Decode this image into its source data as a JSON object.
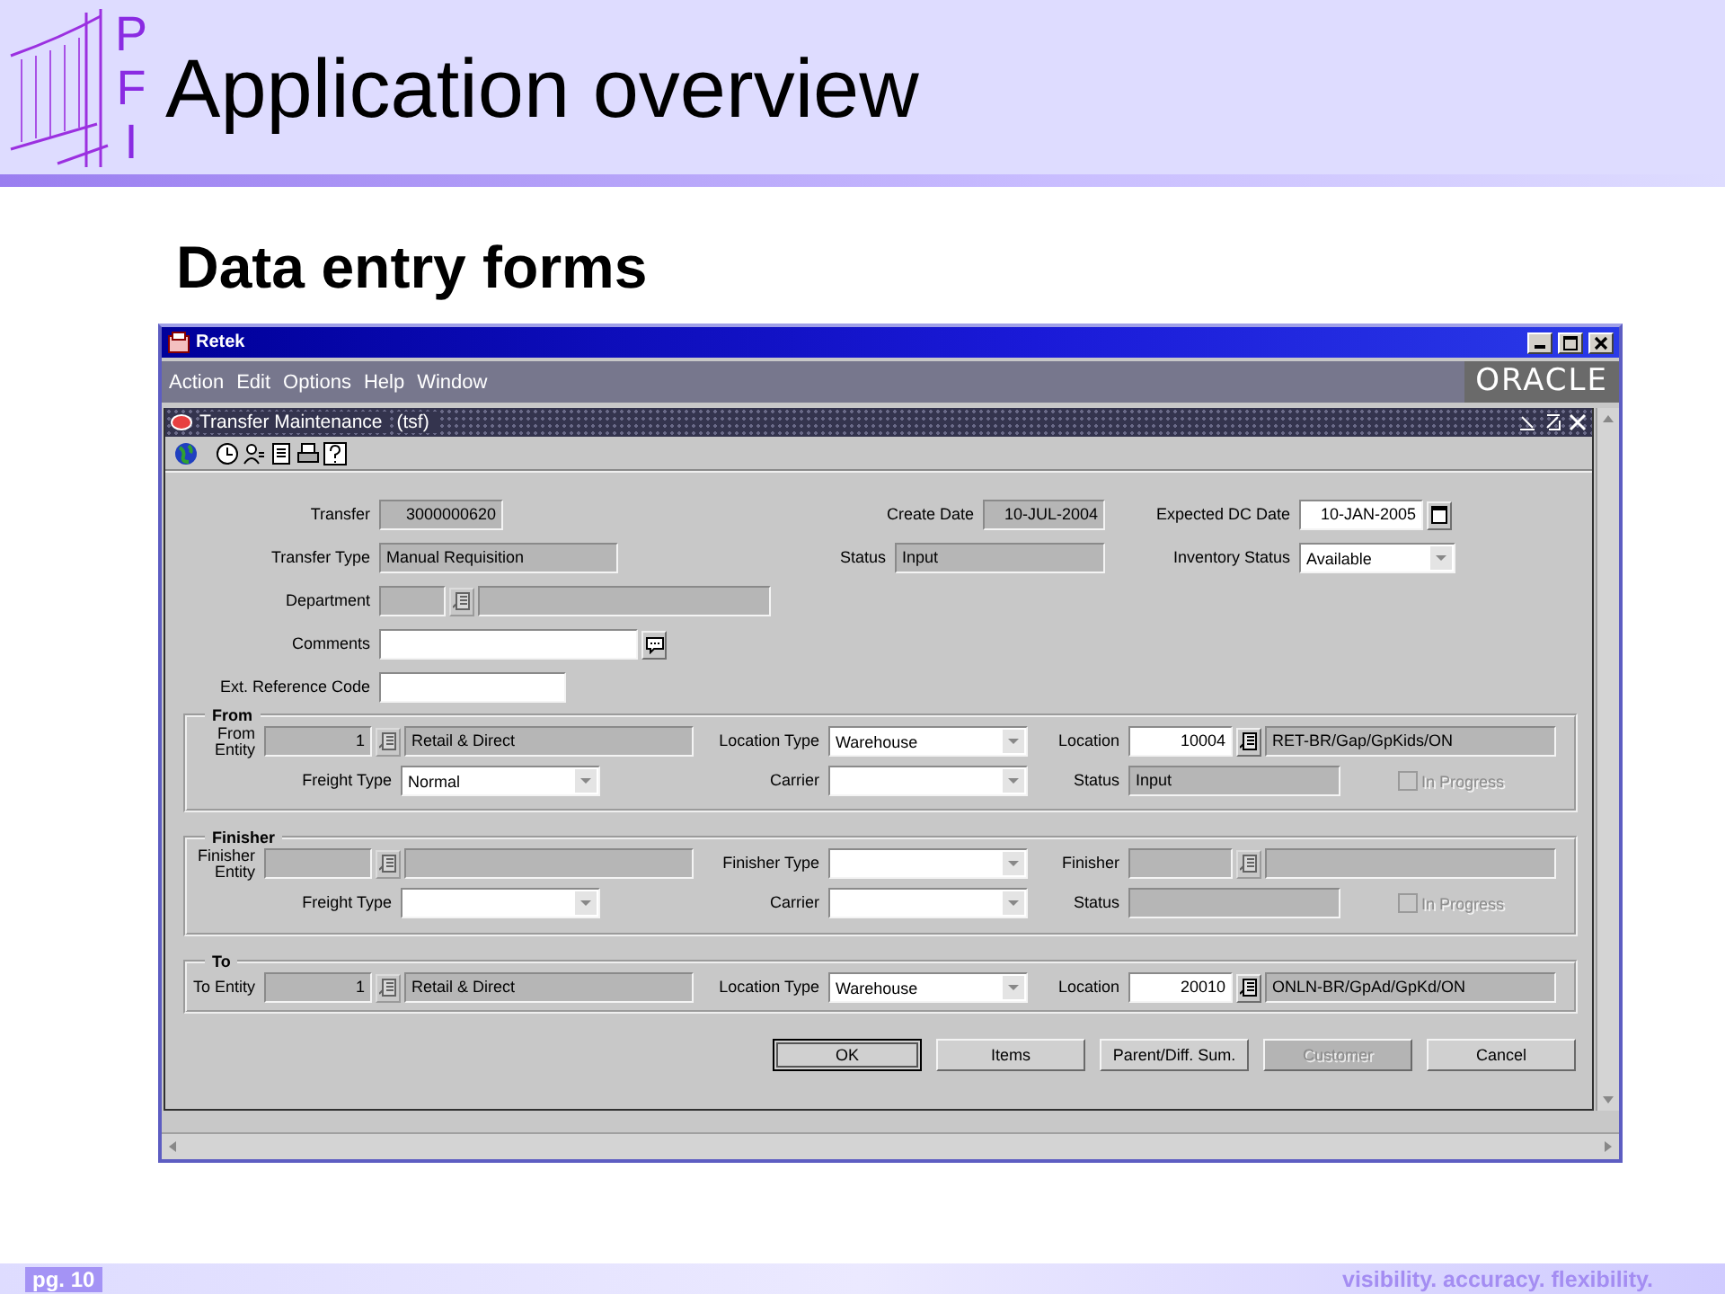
{
  "slide": {
    "logo_letters": [
      "P",
      "F",
      "I"
    ],
    "title": "Application overview",
    "subtitle": "Data entry forms",
    "page": "pg. 10",
    "tagline": "visibility. accuracy. flexibility."
  },
  "window": {
    "title": "Retek",
    "menu": [
      "Action",
      "Edit",
      "Options",
      "Help",
      "Window"
    ],
    "brand": "ORACLE"
  },
  "form": {
    "title": "Transfer Maintenance",
    "code": "(tsf)"
  },
  "header_rows": [
    {
      "cells": [
        {
          "label": "Transfer",
          "kind": "number",
          "value": "3000000620",
          "editable": false
        },
        {
          "label": "Create Date",
          "kind": "number",
          "value": "10-JUL-2004",
          "editable": false
        },
        {
          "label": "Expected DC Date",
          "kind": "date",
          "value": "10-JAN-2005",
          "editable": true
        }
      ]
    },
    {
      "cells": [
        {
          "label": "Transfer Type",
          "kind": "text",
          "value": "Manual Requisition",
          "editable": false
        },
        {
          "label": "Status",
          "kind": "text",
          "value": "Input",
          "editable": false
        },
        {
          "label": "Inventory Status",
          "kind": "combo",
          "value": "Available",
          "editable": true
        }
      ]
    },
    {
      "cells": [
        {
          "label": "Department",
          "kind": "lov",
          "editable": false
        }
      ]
    },
    {
      "cells": [
        {
          "label": "Comments",
          "kind": "comment",
          "editable": true
        }
      ]
    },
    {
      "cells": [
        {
          "label": "Ext. Reference Code",
          "kind": "text",
          "editable": true
        }
      ]
    }
  ],
  "sections": [
    {
      "title": "From",
      "rows": [
        {
          "cells": [
            {
              "label": "From Entity",
              "kind": "lov",
              "code": "1",
              "description": "Retail & Direct",
              "editable": false
            },
            {
              "label": "Location Type",
              "kind": "combo",
              "value": "Warehouse",
              "editable": true
            },
            {
              "label": "Location",
              "kind": "lov",
              "code": "10004",
              "description": "RET-BR/Gap/GpKids/ON",
              "editable": true
            }
          ]
        },
        {
          "cells": [
            {
              "label": "Freight Type",
              "kind": "combo",
              "value": "Normal",
              "editable": true
            },
            {
              "label": "Carrier",
              "kind": "combo",
              "editable": true
            },
            {
              "label": "Status",
              "kind": "text",
              "value": "Input",
              "editable": false
            },
            {
              "label": "In Progress",
              "kind": "checkbox",
              "checked": false,
              "disabled": true
            }
          ]
        }
      ]
    },
    {
      "title": "Finisher",
      "rows": [
        {
          "cells": [
            {
              "label": "Finisher Entity",
              "kind": "lov",
              "editable": false
            },
            {
              "label": "Finisher Type",
              "kind": "combo",
              "editable": true
            },
            {
              "label": "Finisher",
              "kind": "lov",
              "editable": false
            }
          ]
        },
        {
          "cells": [
            {
              "label": "Freight Type",
              "kind": "combo",
              "editable": true
            },
            {
              "label": "Carrier",
              "kind": "combo",
              "editable": true
            },
            {
              "label": "Status",
              "kind": "text",
              "editable": false
            },
            {
              "label": "In Progress",
              "kind": "checkbox",
              "checked": false,
              "disabled": true
            }
          ]
        }
      ]
    },
    {
      "title": "To",
      "rows": [
        {
          "cells": [
            {
              "label": "To Entity",
              "kind": "lov",
              "code": "1",
              "description": "Retail & Direct",
              "editable": false
            },
            {
              "label": "Location Type",
              "kind": "combo",
              "value": "Warehouse",
              "editable": true
            },
            {
              "label": "Location",
              "kind": "lov",
              "code": "20010",
              "description": "ONLN-BR/GpAd/GpKd/ON",
              "editable": true
            }
          ]
        }
      ]
    }
  ],
  "buttons": [
    {
      "label": "OK",
      "default": true,
      "disabled": false
    },
    {
      "label": "Items",
      "default": false,
      "disabled": false
    },
    {
      "label": "Parent/Diff. Sum.",
      "default": false,
      "disabled": false
    },
    {
      "label": "Customer",
      "default": false,
      "disabled": true
    },
    {
      "label": "Cancel",
      "default": false,
      "disabled": false
    }
  ]
}
